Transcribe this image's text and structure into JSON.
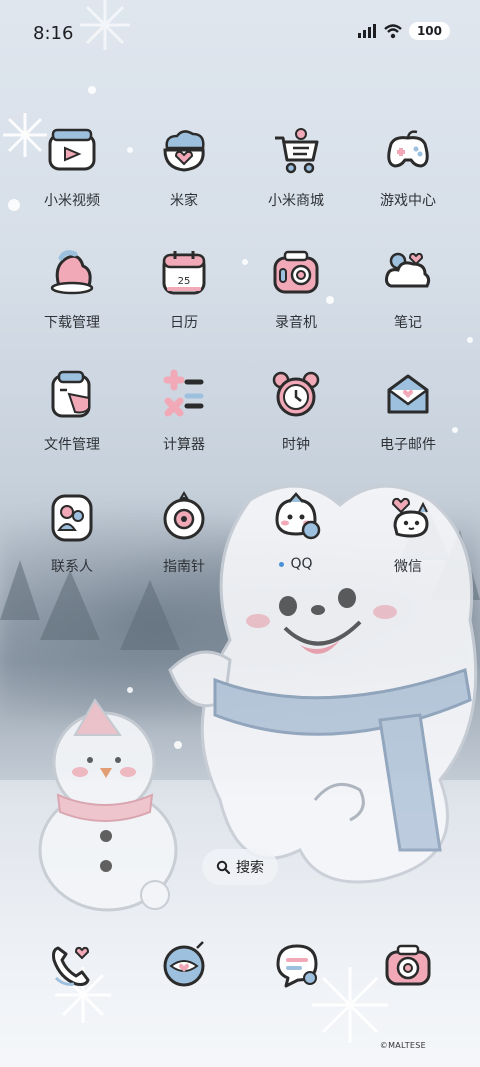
{
  "status_bar": {
    "time": "8:16",
    "battery": "100",
    "icons": [
      "signal-icon",
      "wifi-icon",
      "battery-icon"
    ]
  },
  "apps": [
    {
      "label": "小米视频",
      "icon": "tv-icon"
    },
    {
      "label": "米家",
      "icon": "cloud-heart-icon"
    },
    {
      "label": "小米商城",
      "icon": "cart-icon"
    },
    {
      "label": "游戏中心",
      "icon": "gamepad-icon"
    },
    {
      "label": "下载管理",
      "icon": "download-icon"
    },
    {
      "label": "日历",
      "icon": "calendar-icon"
    },
    {
      "label": "录音机",
      "icon": "recorder-icon"
    },
    {
      "label": "笔记",
      "icon": "notes-icon"
    },
    {
      "label": "文件管理",
      "icon": "folder-icon"
    },
    {
      "label": "计算器",
      "icon": "calculator-icon"
    },
    {
      "label": "时钟",
      "icon": "alarm-clock-icon"
    },
    {
      "label": "电子邮件",
      "icon": "mail-icon"
    },
    {
      "label": "联系人",
      "icon": "contacts-icon"
    },
    {
      "label": "指南针",
      "icon": "compass-icon"
    },
    {
      "label": "QQ",
      "icon": "qq-icon",
      "new_dot": true
    },
    {
      "label": "微信",
      "icon": "wechat-icon"
    }
  ],
  "calendar_day": "25",
  "search": {
    "label": "搜索"
  },
  "dock": [
    {
      "icon": "phone-icon"
    },
    {
      "icon": "browser-icon"
    },
    {
      "icon": "messages-icon"
    },
    {
      "icon": "camera-icon"
    }
  ],
  "credit": "©MALTESE",
  "colors": {
    "pink": "#f1a9b8",
    "blue": "#9dc0de",
    "outline": "#2b2b2b",
    "label": "#2f3338"
  }
}
